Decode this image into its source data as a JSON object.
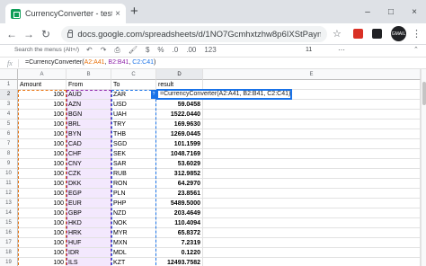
{
  "browser": {
    "tab_title": "CurrencyConverter - test - Goog",
    "tab_close": "×",
    "new_tab": "+",
    "url": "docs.google.com/spreadsheets/d/1NO7Gcmhxtzhw8p6IXStPayn6IqKLx...",
    "window_buttons": [
      "–",
      "□",
      "×"
    ],
    "avatar": "GMAIL"
  },
  "sheets_toolbar": {
    "search_menus": "Search the menus (Alt+/)",
    "format_more": "123",
    "font_size": "11"
  },
  "formula_bar": {
    "fx": "fx",
    "prefix": "=CurrencyConverter(",
    "arg_a": "A2:A41",
    "sep1": ", ",
    "arg_b": "B2:B41",
    "sep2": ", ",
    "arg_c": "C2:C41",
    "suffix": ")"
  },
  "editor_text": "=CurrencyConverter(A2:A41, B2:B41, C2:C41)",
  "columns": [
    "A",
    "B",
    "C",
    "D",
    "E"
  ],
  "header_row": {
    "a": "Amount",
    "b": "From",
    "c": "To",
    "d": "result"
  },
  "rows": [
    {
      "n": "1"
    },
    {
      "n": "2",
      "a": "100",
      "b": "AUD",
      "c": "ZAR",
      "d": ""
    },
    {
      "n": "3",
      "a": "100",
      "b": "AZN",
      "c": "USD",
      "d": "59.0458"
    },
    {
      "n": "4",
      "a": "100",
      "b": "BGN",
      "c": "UAH",
      "d": "1522.0440"
    },
    {
      "n": "5",
      "a": "100",
      "b": "BRL",
      "c": "TRY",
      "d": "169.9630"
    },
    {
      "n": "6",
      "a": "100",
      "b": "BYN",
      "c": "THB",
      "d": "1269.0445"
    },
    {
      "n": "7",
      "a": "100",
      "b": "CAD",
      "c": "SGD",
      "d": "101.1599"
    },
    {
      "n": "8",
      "a": "100",
      "b": "CHF",
      "c": "SEK",
      "d": "1048.7169"
    },
    {
      "n": "9",
      "a": "100",
      "b": "CNY",
      "c": "SAR",
      "d": "53.6029"
    },
    {
      "n": "10",
      "a": "100",
      "b": "CZK",
      "c": "RUB",
      "d": "312.9852"
    },
    {
      "n": "11",
      "a": "100",
      "b": "DKK",
      "c": "RON",
      "d": "64.2970"
    },
    {
      "n": "12",
      "a": "100",
      "b": "EGP",
      "c": "PLN",
      "d": "23.8561"
    },
    {
      "n": "13",
      "a": "100",
      "b": "EUR",
      "c": "PHP",
      "d": "5489.5000"
    },
    {
      "n": "14",
      "a": "100",
      "b": "GBP",
      "c": "NZD",
      "d": "203.4649"
    },
    {
      "n": "15",
      "a": "100",
      "b": "HKD",
      "c": "NOK",
      "d": "110.4094"
    },
    {
      "n": "16",
      "a": "100",
      "b": "HRK",
      "c": "MYR",
      "d": "65.8372"
    },
    {
      "n": "17",
      "a": "100",
      "b": "HUF",
      "c": "MXN",
      "d": "7.2319"
    },
    {
      "n": "18",
      "a": "100",
      "b": "IDR",
      "c": "MDL",
      "d": "0.1220"
    },
    {
      "n": "19",
      "a": "100",
      "b": "ILS",
      "c": "KZT",
      "d": "12493.7582"
    }
  ]
}
